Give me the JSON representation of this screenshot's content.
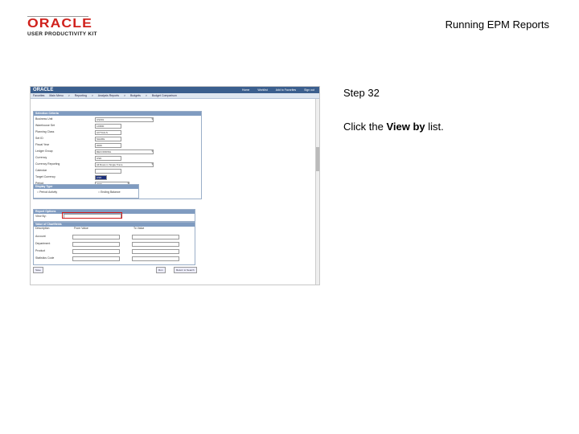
{
  "logo": {
    "word": "ORACLE",
    "sub": "USER PRODUCTIVITY KIT"
  },
  "header": {
    "title": "Running EPM Reports"
  },
  "screenshot": {
    "app_logo": "ORACLE",
    "top_links": [
      "Home",
      "Worklist",
      "Add to Favorites",
      "Sign out"
    ],
    "nav": [
      "Favorites",
      "Main Menu",
      ">",
      "Reporting",
      ">",
      "Analysis Reports",
      ">",
      "Budgets",
      ">",
      "Budget Comparison"
    ],
    "criteria_title": "Selection Criteria",
    "fields": [
      {
        "label": "Business Unit",
        "value": "US001"
      },
      {
        "label": "Warehouse Set",
        "value": "LDR00"
      },
      {
        "label": "Planning Class",
        "value": "ACTUALS"
      },
      {
        "label": "Set ID",
        "value": "SHARE"
      },
      {
        "label": "Fiscal Year",
        "value": "2009"
      },
      {
        "label": "Ledger Group",
        "value": "RECORDING"
      },
      {
        "label": "Currency",
        "value": "USD"
      },
      {
        "label": "Currency Reporting",
        "value": "All Rows in Single Trans."
      },
      {
        "label": "Calendar",
        "value": ""
      },
      {
        "label": "Target Currency",
        "value": "USD"
      },
      {
        "label": "Period",
        "value": "2009"
      }
    ],
    "display_title": "Display Type",
    "radio_period": "Period Activity",
    "radio_ending": "Ending Balance",
    "report_options_title": "Report Options",
    "view_by_label": "View By:",
    "chartfields_title": "Value of Chartfields",
    "chartfields_cols": [
      "Description",
      "From Value",
      "To Value"
    ],
    "chartfields_rows": [
      "Account",
      "Department",
      "Product",
      "Statistics Code"
    ],
    "save_label": "Save",
    "run_label": "Run",
    "return_label": "Return to Search"
  },
  "step": "Step 32",
  "instruction": {
    "pre": "Click the ",
    "bold": "View by",
    "post": " list."
  }
}
